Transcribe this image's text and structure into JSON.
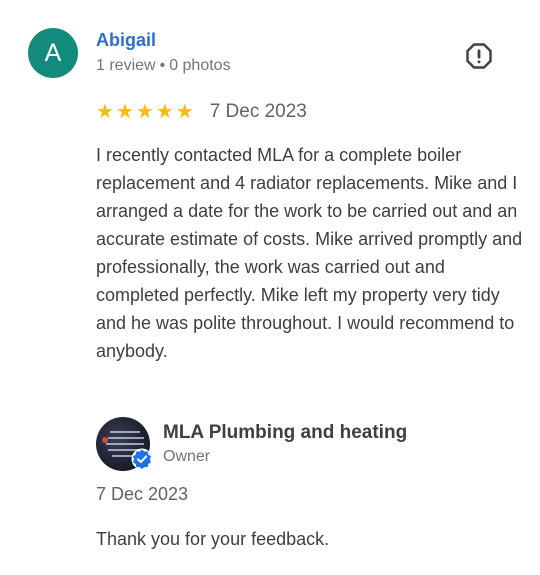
{
  "reviewer": {
    "avatar_letter": "A",
    "avatar_color": "#128a7c",
    "name": "Abigail",
    "review_count": "1 review",
    "separator": "•",
    "photo_count": "0 photos"
  },
  "report_icon": "exclamation-circle-icon",
  "review": {
    "rating": 5,
    "rating_max": 5,
    "star_color": "#fbbc04",
    "date": "7 Dec 2023",
    "text": "I recently contacted MLA for a complete boiler replacement and 4 radiator replacements. Mike and I arranged a date for the work to be carried out and an accurate estimate of costs. Mike arrived promptly and professionally, the work was carried out and completed perfectly. Mike left my property very tidy and he was polite throughout. I would recommend to anybody."
  },
  "owner_reply": {
    "name": "MLA Plumbing and heating",
    "role": "Owner",
    "verified_icon": "verified-check-icon",
    "verified_color": "#1a73e8",
    "date": "7 Dec 2023",
    "text": "Thank you for your feedback."
  }
}
